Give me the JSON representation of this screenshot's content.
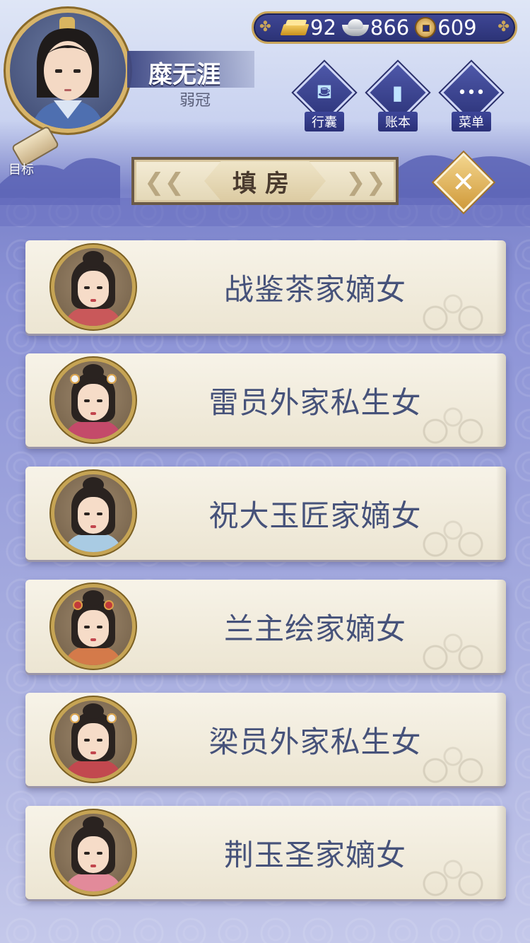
{
  "currency": {
    "gold": "92",
    "silver": "866",
    "coins": "609"
  },
  "player": {
    "name": "糜无涯",
    "title": "弱冠"
  },
  "menu": {
    "bag_label": "行囊",
    "ledger_label": "账本",
    "menu_label": "菜单",
    "goal_label": "目标"
  },
  "panel": {
    "title": "填房",
    "close_symbol": "✕"
  },
  "candidates": [
    {
      "label": "战鉴茶家嫡女",
      "robe": "#c9585a"
    },
    {
      "label": "雷员外家私生女",
      "robe": "#c44a6a"
    },
    {
      "label": "祝大玉匠家嫡女",
      "robe": "#a9cbe3"
    },
    {
      "label": "兰主绘家嫡女",
      "robe": "#d47a4a"
    },
    {
      "label": "梁员外家私生女",
      "robe": "#c2484f"
    },
    {
      "label": "荆玉圣家嫡女",
      "robe": "#e28a9a"
    }
  ]
}
